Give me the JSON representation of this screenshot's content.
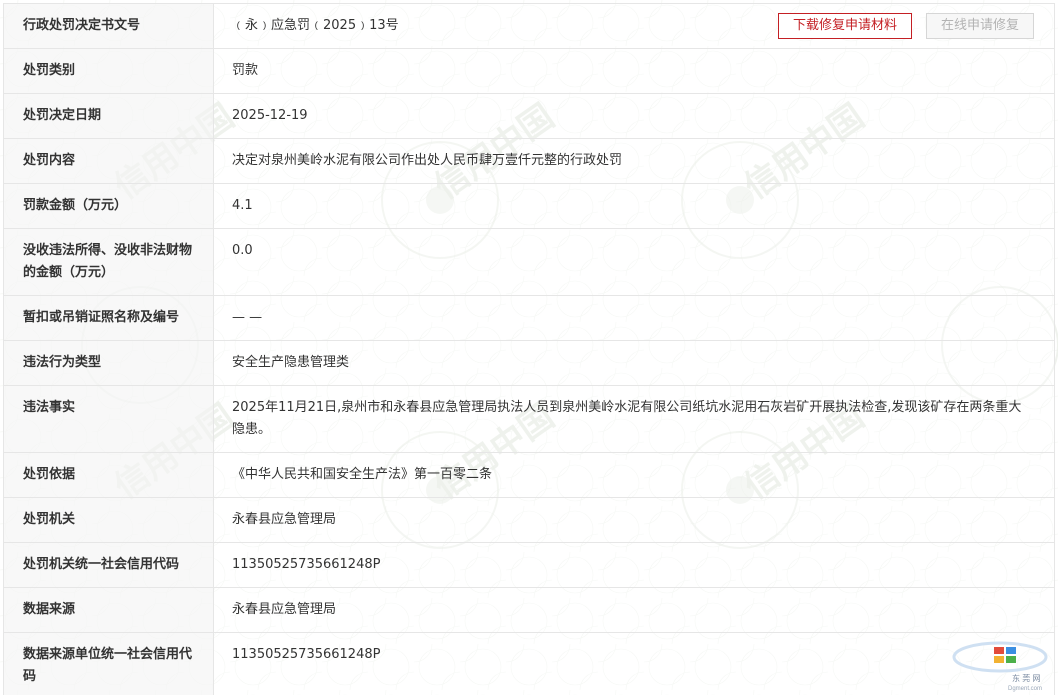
{
  "header": {
    "label": "行政处罚决定书文号",
    "value": "﹙永﹚应急罚﹙2025﹚13号",
    "buttons": {
      "download_label": "下载修复申请材料",
      "online_repair_label": "在线申请修复"
    }
  },
  "rows": [
    {
      "label": "处罚类别",
      "value": "罚款"
    },
    {
      "label": "处罚决定日期",
      "value": "2025-12-19"
    },
    {
      "label": "处罚内容",
      "value": "决定对泉州美岭水泥有限公司作出处人民币肆万壹仟元整的行政处罚"
    },
    {
      "label": "罚款金额（万元）",
      "value": "4.1"
    },
    {
      "label": "没收违法所得、没收非法财物的金额（万元）",
      "value": "0.0"
    },
    {
      "label": "暂扣或吊销证照名称及编号",
      "value": "— —"
    },
    {
      "label": "违法行为类型",
      "value": "安全生产隐患管理类"
    },
    {
      "label": "违法事实",
      "value": "2025年11月21日,泉州市和永春县应急管理局执法人员到泉州美岭水泥有限公司纸坑水泥用石灰岩矿开展执法检查,发现该矿存在两条重大隐患。"
    },
    {
      "label": "处罚依据",
      "value": "《中华人民共和国安全生产法》第一百零二条"
    },
    {
      "label": "处罚机关",
      "value": "永春县应急管理局"
    },
    {
      "label": "处罚机关统一社会信用代码",
      "value": "11350525735661248P"
    },
    {
      "label": "数据来源",
      "value": "永春县应急管理局"
    },
    {
      "label": "数据来源单位统一社会信用代码",
      "value": "11350525735661248P"
    }
  ],
  "watermark_text": "信用中国",
  "colors": {
    "accent_red": "#c41f24",
    "border": "#e6e6e6",
    "label_bg": "#f5f5f5",
    "watermark": "#e8efe6"
  },
  "corner_logo": {
    "icon": "site-logo-icon",
    "text": "东 莞 网",
    "subtext": "Dgment.com"
  }
}
